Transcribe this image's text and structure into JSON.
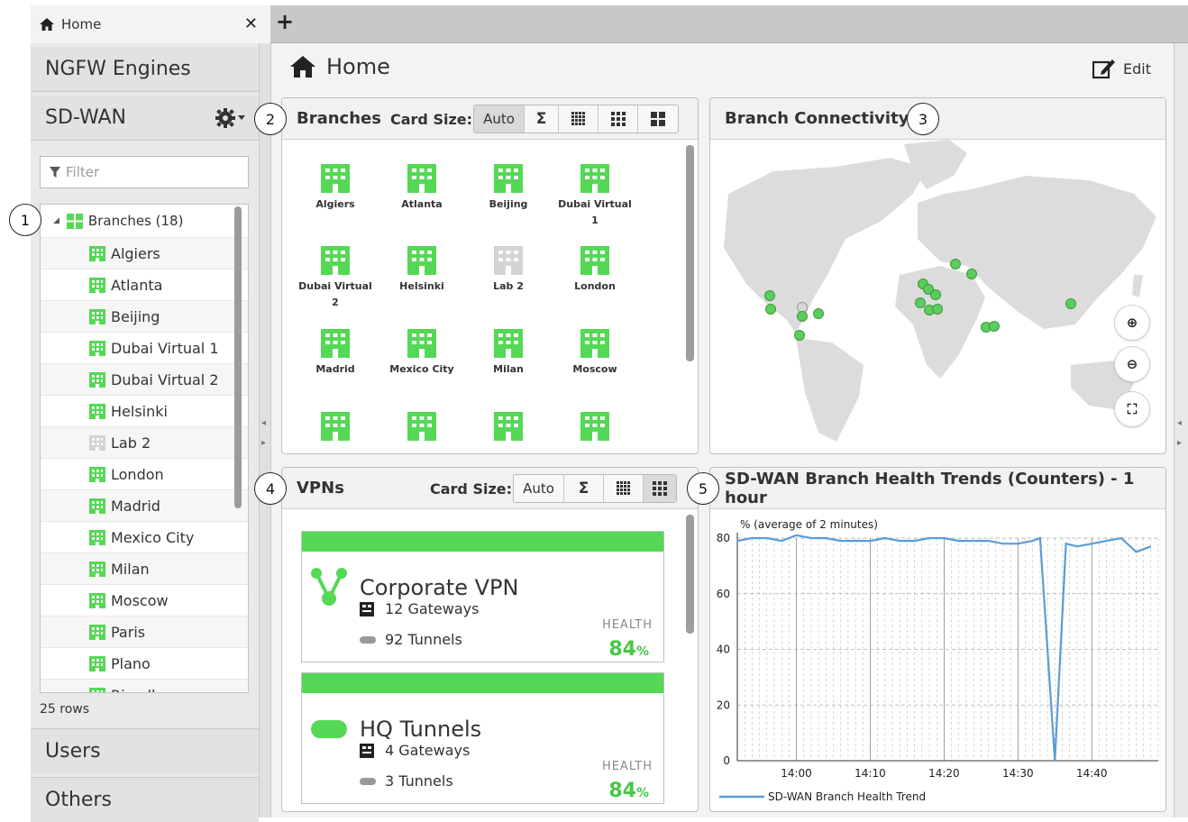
{
  "tab": {
    "title": "Home",
    "close": "✕",
    "add": "+"
  },
  "sidebar": {
    "ngfw": "NGFW Engines",
    "sdwan": "SD-WAN",
    "filter_placeholder": "Filter",
    "tree_root": "Branches (18)",
    "items": [
      "Algiers",
      "Atlanta",
      "Beijing",
      "Dubai Virtual 1",
      "Dubai Virtual 2",
      "Helsinki",
      "Lab 2",
      "London",
      "Madrid",
      "Mexico City",
      "Milan",
      "Moscow",
      "Paris",
      "Plano",
      "Rivadh"
    ],
    "rows": "25 rows",
    "users": "Users",
    "others": "Others"
  },
  "main": {
    "title": "Home",
    "edit": "Edit"
  },
  "branches_panel": {
    "title": "Branches",
    "card_size_label": "Card Size:",
    "card_size_options": [
      "Auto",
      "Σ",
      "▦",
      "▦",
      "▦"
    ],
    "cards": [
      {
        "name": "Algiers",
        "status": "up"
      },
      {
        "name": "Atlanta",
        "status": "up"
      },
      {
        "name": "Beijing",
        "status": "up"
      },
      {
        "name": "Dubai Virtual 1",
        "status": "up"
      },
      {
        "name": "Dubai Virtual 2",
        "status": "up"
      },
      {
        "name": "Helsinki",
        "status": "up"
      },
      {
        "name": "Lab 2",
        "status": "unknown"
      },
      {
        "name": "London",
        "status": "up"
      },
      {
        "name": "Madrid",
        "status": "up"
      },
      {
        "name": "Mexico City",
        "status": "up"
      },
      {
        "name": "Milan",
        "status": "up"
      },
      {
        "name": "Moscow",
        "status": "up"
      },
      {
        "name": "",
        "status": "up"
      },
      {
        "name": "",
        "status": "up"
      },
      {
        "name": "",
        "status": "up"
      },
      {
        "name": "",
        "status": "up"
      }
    ]
  },
  "connectivity_panel": {
    "title": "Branch Connectivity",
    "zoom_in": "⊕",
    "zoom_out": "⊖",
    "fit": "⛶"
  },
  "vpns_panel": {
    "title": "VPNs",
    "card_size_label": "Card Size:",
    "card_size_options": [
      "Auto",
      "Σ",
      "▦",
      "▦"
    ],
    "vpns": [
      {
        "name": "Corporate VPN",
        "gateways": "12 Gateways",
        "tunnels": "92 Tunnels",
        "health_label": "HEALTH",
        "health": "84",
        "unit": "%"
      },
      {
        "name": "HQ Tunnels",
        "gateways": "4 Gateways",
        "tunnels": "3 Tunnels",
        "health_label": "HEALTH",
        "health": "84",
        "unit": "%"
      }
    ]
  },
  "trends_panel": {
    "title": "SD-WAN Branch Health Trends (Counters) - 1 hour"
  },
  "callouts": [
    "1",
    "2",
    "3",
    "4",
    "5"
  ],
  "colors": {
    "green": "#55d855",
    "grey": "#d4d4d4",
    "line": "#5b9bd5"
  },
  "chart_data": {
    "type": "line",
    "ylabel": "% (average of 2 minutes)",
    "ylim": [
      0,
      80
    ],
    "yticks": [
      "0",
      "20",
      "40",
      "60",
      "80"
    ],
    "xticks": [
      "14:00",
      "14:10",
      "14:20",
      "14:30",
      "14:40"
    ],
    "x": [
      -8,
      -6,
      -4,
      -2,
      0,
      2,
      4,
      6,
      8,
      10,
      12,
      14,
      16,
      18,
      20,
      22,
      24,
      26,
      28,
      30,
      32,
      33,
      35,
      36.5,
      38,
      40,
      42,
      44,
      46,
      48
    ],
    "series": [
      {
        "name": "SD-WAN Branch Health Trend",
        "values": [
          79,
          80,
          80,
          79,
          81,
          80,
          80,
          79,
          79,
          79,
          80,
          79,
          79,
          80,
          80,
          79,
          79,
          79,
          78,
          78,
          79,
          80,
          0,
          78,
          77,
          78,
          79,
          80,
          75,
          77
        ]
      }
    ],
    "grid": true,
    "legend": "bottom-left"
  }
}
